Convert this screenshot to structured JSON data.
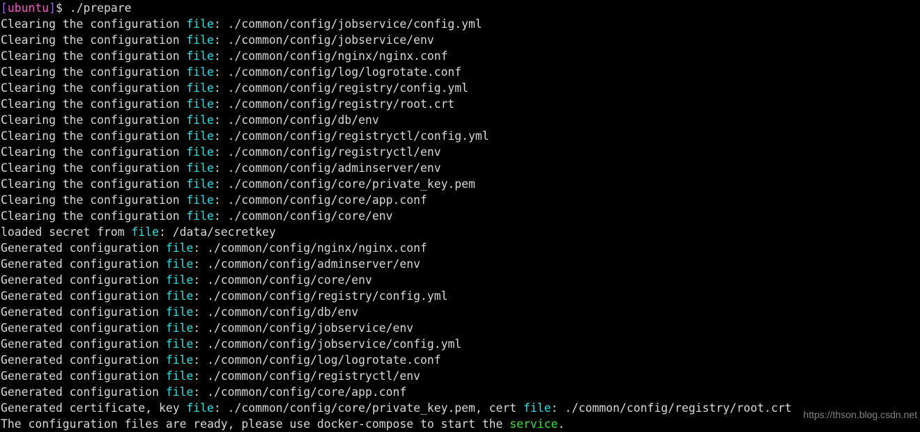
{
  "terminal": {
    "background_color": "#000000",
    "foreground_color": "#d8d8d8",
    "accent_colors": {
      "cyan": "#1ee5e5",
      "green": "#2ee62e",
      "magenta": "#ff55cc",
      "violet": "#a05cff"
    },
    "prompt": {
      "bracket_open": "[",
      "host": "ubuntu",
      "bracket_close": "]",
      "symbol": "$",
      "command": " ./prepare"
    },
    "lines": [
      {
        "type": "prompt"
      },
      {
        "pre": "Clearing the configuration ",
        "kw": "file",
        "post": ": ./common/config/jobservice/config.yml"
      },
      {
        "pre": "Clearing the configuration ",
        "kw": "file",
        "post": ": ./common/config/jobservice/env"
      },
      {
        "pre": "Clearing the configuration ",
        "kw": "file",
        "post": ": ./common/config/nginx/nginx.conf"
      },
      {
        "pre": "Clearing the configuration ",
        "kw": "file",
        "post": ": ./common/config/log/logrotate.conf"
      },
      {
        "pre": "Clearing the configuration ",
        "kw": "file",
        "post": ": ./common/config/registry/config.yml"
      },
      {
        "pre": "Clearing the configuration ",
        "kw": "file",
        "post": ": ./common/config/registry/root.crt"
      },
      {
        "pre": "Clearing the configuration ",
        "kw": "file",
        "post": ": ./common/config/db/env"
      },
      {
        "pre": "Clearing the configuration ",
        "kw": "file",
        "post": ": ./common/config/registryctl/config.yml"
      },
      {
        "pre": "Clearing the configuration ",
        "kw": "file",
        "post": ": ./common/config/registryctl/env"
      },
      {
        "pre": "Clearing the configuration ",
        "kw": "file",
        "post": ": ./common/config/adminserver/env"
      },
      {
        "pre": "Clearing the configuration ",
        "kw": "file",
        "post": ": ./common/config/core/private_key.pem"
      },
      {
        "pre": "Clearing the configuration ",
        "kw": "file",
        "post": ": ./common/config/core/app.conf"
      },
      {
        "pre": "Clearing the configuration ",
        "kw": "file",
        "post": ": ./common/config/core/env"
      },
      {
        "pre": "loaded secret from ",
        "kw": "file",
        "post": ": /data/secretkey"
      },
      {
        "pre": "Generated configuration ",
        "kw": "file",
        "post": ": ./common/config/nginx/nginx.conf"
      },
      {
        "pre": "Generated configuration ",
        "kw": "file",
        "post": ": ./common/config/adminserver/env"
      },
      {
        "pre": "Generated configuration ",
        "kw": "file",
        "post": ": ./common/config/core/env"
      },
      {
        "pre": "Generated configuration ",
        "kw": "file",
        "post": ": ./common/config/registry/config.yml"
      },
      {
        "pre": "Generated configuration ",
        "kw": "file",
        "post": ": ./common/config/db/env"
      },
      {
        "pre": "Generated configuration ",
        "kw": "file",
        "post": ": ./common/config/jobservice/env"
      },
      {
        "pre": "Generated configuration ",
        "kw": "file",
        "post": ": ./common/config/jobservice/config.yml"
      },
      {
        "pre": "Generated configuration ",
        "kw": "file",
        "post": ": ./common/config/log/logrotate.conf"
      },
      {
        "pre": "Generated configuration ",
        "kw": "file",
        "post": ": ./common/config/registryctl/env"
      },
      {
        "pre": "Generated configuration ",
        "kw": "file",
        "post": ": ./common/config/core/app.conf"
      },
      {
        "pre": "Generated certificate, key ",
        "kw": "file",
        "mid": ": ./common/config/core/private_key.pem, cert ",
        "kw2": "file",
        "post": ": ./common/config/registry/root.crt"
      },
      {
        "pre": "The configuration files are ready, please use docker-compose to start the ",
        "kw3": "service",
        "post": "."
      }
    ]
  },
  "watermark": {
    "text": "https://thson.blog.csdn.net"
  }
}
